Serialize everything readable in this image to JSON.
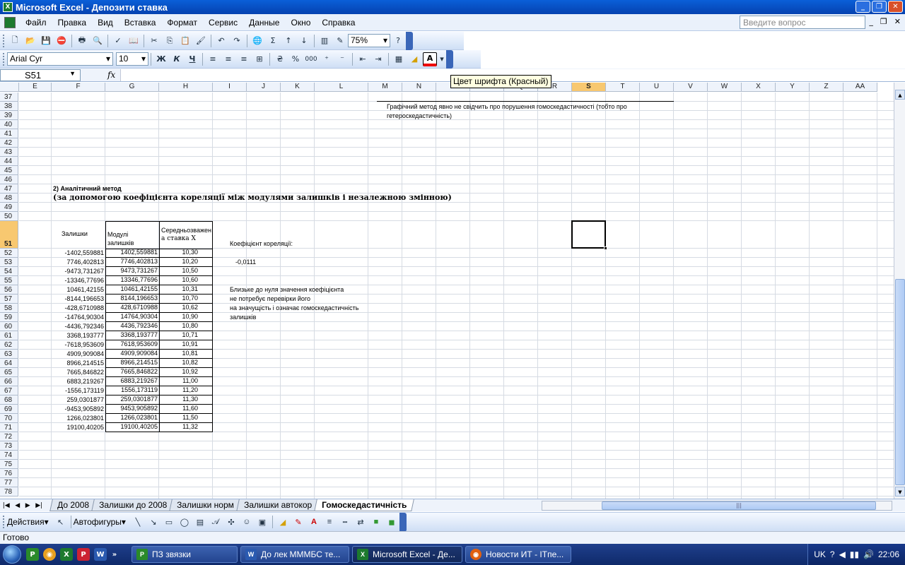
{
  "window": {
    "title": "Microsoft Excel - Депозити ставка"
  },
  "menu": [
    "Файл",
    "Правка",
    "Вид",
    "Вставка",
    "Формат",
    "Сервис",
    "Данные",
    "Окно",
    "Справка"
  ],
  "ask": {
    "placeholder": "Введите вопрос"
  },
  "toolbar": {
    "zoom": "75%"
  },
  "formatting": {
    "font": "Arial Cyr",
    "size": "10",
    "bold": "Ж",
    "italic": "К",
    "underline": "Ч",
    "percent": "%",
    "thousands": "000"
  },
  "formula": {
    "cell_ref": "S51",
    "fx": "fx"
  },
  "tooltip": "Цвет шрифта (Красный)",
  "columns": [
    "E",
    "F",
    "G",
    "H",
    "I",
    "J",
    "K",
    "L",
    "M",
    "N",
    "O",
    "P",
    "Q",
    "R",
    "S",
    "T",
    "U",
    "V",
    "W",
    "X",
    "Y",
    "Z",
    "AA"
  ],
  "selected_column": "S",
  "rows": [
    "37",
    "38",
    "39",
    "40",
    "41",
    "42",
    "43",
    "44",
    "45",
    "46",
    "47",
    "48",
    "49",
    "50",
    "51",
    "52",
    "53",
    "54",
    "55",
    "56",
    "57",
    "58",
    "59",
    "60",
    "61",
    "62",
    "63",
    "64",
    "65",
    "66",
    "67",
    "68",
    "69",
    "70",
    "71",
    "72",
    "73",
    "74",
    "75",
    "76",
    "77",
    "78"
  ],
  "selected_row": "51",
  "sheet": {
    "note_graph": "Графічний метод явно не свідчить про порушення гомоскедастичності (тобто про",
    "note_graph2": "гетероскедастичність)",
    "section_title": "2) Аналітичний метод",
    "section_sub": "(за допомогою коефіцієнта кореляції між модулями залишків і незалежною змінною)",
    "hdr_resid": "Залишки",
    "hdr_abs1": "Модулі",
    "hdr_abs2": "залишків",
    "hdr_rate1": "Середньозважен",
    "hdr_rate2": "а ставка Х",
    "corr_label": "Коефіцієнт кореляції:",
    "corr_value": "-0,0111",
    "concl1": "Близьке до нуля значення коефіцієнта",
    "concl2": "не потребує перевірки його",
    "concl3": "на значущість і означає гомоскедастичність",
    "concl4": "залишків",
    "table": [
      [
        "-1402,559881",
        "1402,559881",
        "10,30"
      ],
      [
        "7746,402813",
        "7746,402813",
        "10,20"
      ],
      [
        "-9473,731267",
        "9473,731267",
        "10,50"
      ],
      [
        "-13346,77696",
        "13346,77696",
        "10,60"
      ],
      [
        "10461,42155",
        "10461,42155",
        "10,31"
      ],
      [
        "-8144,196653",
        "8144,196653",
        "10,70"
      ],
      [
        "-428,6710988",
        "428,6710988",
        "10,62"
      ],
      [
        "-14764,90304",
        "14764,90304",
        "10,90"
      ],
      [
        "-4436,792346",
        "4436,792346",
        "10,80"
      ],
      [
        "3368,193777",
        "3368,193777",
        "10,71"
      ],
      [
        "-7618,953609",
        "7618,953609",
        "10,91"
      ],
      [
        "4909,909084",
        "4909,909084",
        "10,81"
      ],
      [
        "8966,214515",
        "8966,214515",
        "10,82"
      ],
      [
        "7665,846822",
        "7665,846822",
        "10,92"
      ],
      [
        "6883,219267",
        "6883,219267",
        "11,00"
      ],
      [
        "-1556,173119",
        "1556,173119",
        "11,20"
      ],
      [
        "259,0301877",
        "259,0301877",
        "11,30"
      ],
      [
        "-9453,905892",
        "9453,905892",
        "11,60"
      ],
      [
        "1266,023801",
        "1266,023801",
        "11,50"
      ],
      [
        "19100,40205",
        "19100,40205",
        "11,32"
      ]
    ]
  },
  "tabs": [
    "До 2008",
    "Залишки до 2008",
    "Залишки норм",
    "Залишки автокор",
    "Гомоскедастичність"
  ],
  "active_tab": "Гомоскедастичність",
  "draw": {
    "actions": "Действия",
    "autoshapes": "Автофигуры"
  },
  "status": "Готово",
  "taskbar": {
    "tasks": [
      "ПЗ звязки",
      "До лек МММБС те...",
      "Microsoft Excel - Де...",
      "Новости ИТ - ITпе..."
    ],
    "lang": "UK",
    "time": "22:06"
  },
  "colors": {
    "title": "#0a5fd8",
    "selected_header": "#f8c870",
    "taskbar": "#1f3f8c"
  }
}
